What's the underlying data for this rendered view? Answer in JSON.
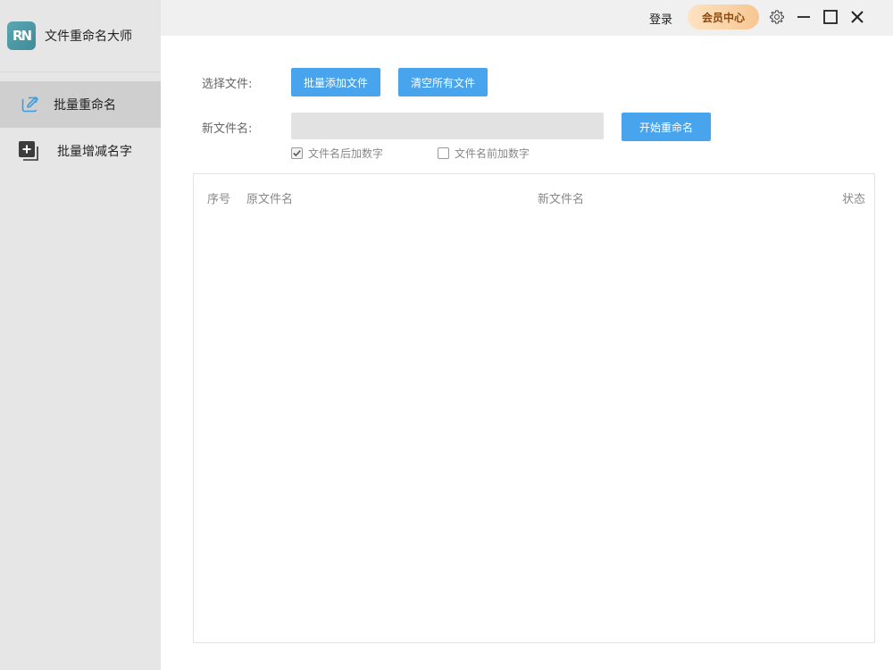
{
  "app": {
    "logo_text": "RN",
    "title": "文件重命名大师"
  },
  "sidebar": {
    "items": [
      {
        "label": "批量重命名",
        "icon": "edit-icon",
        "active": true
      },
      {
        "label": "批量增减名字",
        "icon": "add-copy-icon",
        "active": false
      }
    ]
  },
  "topbar": {
    "login_label": "登录",
    "vip_label": "会员中心",
    "icons": [
      "gear-icon",
      "minimize-icon",
      "maximize-icon",
      "close-icon"
    ]
  },
  "form": {
    "select_files_label": "选择文件:",
    "add_files_button": "批量添加文件",
    "clear_files_button": "清空所有文件",
    "new_name_label": "新文件名:",
    "new_name_value": "",
    "start_button": "开始重命名",
    "options": [
      {
        "label": "文件名后加数字",
        "checked": true
      },
      {
        "label": "文件名前加数字",
        "checked": false
      }
    ]
  },
  "table": {
    "columns": [
      "序号",
      "原文件名",
      "新文件名",
      "状态"
    ],
    "rows": []
  },
  "colors": {
    "sidebar_bg": "#e6e6e6",
    "sidebar_active": "#cfcfcf",
    "topbar_bg": "#f0f0f0",
    "primary_button": "#49a4ee",
    "vip_gradient_start": "#fde3c2",
    "vip_gradient_end": "#f7c691"
  }
}
